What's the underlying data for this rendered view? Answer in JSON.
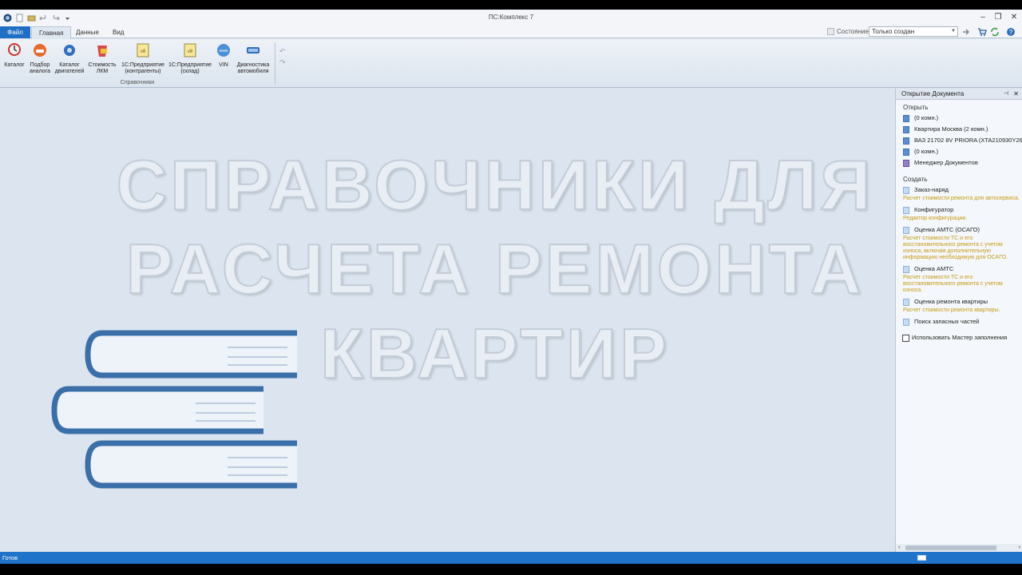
{
  "window": {
    "title": "ПС:Комплекс 7"
  },
  "tabs": [
    {
      "label": "Файл"
    },
    {
      "label": "Главная"
    },
    {
      "label": "Данные"
    },
    {
      "label": "Вид"
    }
  ],
  "state": {
    "label": "Состояние:",
    "value": "Только создан"
  },
  "ribbon": {
    "buttons": [
      {
        "label": "Каталог"
      },
      {
        "label": "Подбор\nаналога"
      },
      {
        "label": "Каталог\nдвигателей"
      },
      {
        "label": "Стоимость\nЛКМ"
      },
      {
        "label": "1С:Предприятие\n(контрагенты)"
      },
      {
        "label": "1С:Предприятие\n(склад)"
      },
      {
        "label": "VIN"
      },
      {
        "label": "Диагностика\nавтомобиля"
      }
    ],
    "group_label": "Справочники"
  },
  "banner": {
    "line1": "СПРАВОЧНИКИ ДЛЯ",
    "line2": "РАСЧЕТА РЕМОНТА",
    "line3": "КВАРТИР"
  },
  "panel": {
    "title": "Открытие Документа",
    "open_title": "Открыть",
    "open_items": [
      {
        "label": "(0 комн.)"
      },
      {
        "label": "Квартира Москва (2 комн.)"
      },
      {
        "label": "ВАЗ 21702 8V PRIORA (XTA210930Y269"
      },
      {
        "label": "(0 комн.)"
      },
      {
        "label": "Менеджер Документов"
      }
    ],
    "create_title": "Создать",
    "create_items": [
      {
        "label": "Заказ-наряд",
        "desc": "Расчет стоимости ремонта для автосервиса."
      },
      {
        "label": "Конфигуратор",
        "desc": "Редактор конфигурации."
      },
      {
        "label": "Оценка АМТС (ОСАГО)",
        "desc": "Расчет стоимости ТС и его восстановительного ремонта с учетом износа, включая дополнительную информацию необходимую для ОСАГО."
      },
      {
        "label": "Оценка АМТС",
        "desc": "Расчет стоимости ТС и его восстановительного ремонта с учетом износа."
      },
      {
        "label": "Оценка ремонта квартиры",
        "desc": "Расчет стоимости ремонта квартиры."
      },
      {
        "label": "Поиск запасных частей",
        "desc": ""
      }
    ],
    "wizard_label": "Использовать Мастер заполнения"
  },
  "status": {
    "text": "Готов"
  },
  "colors": {
    "accent": "#1f73c8",
    "hint": "#c79a12",
    "book": "#3b6faa"
  }
}
